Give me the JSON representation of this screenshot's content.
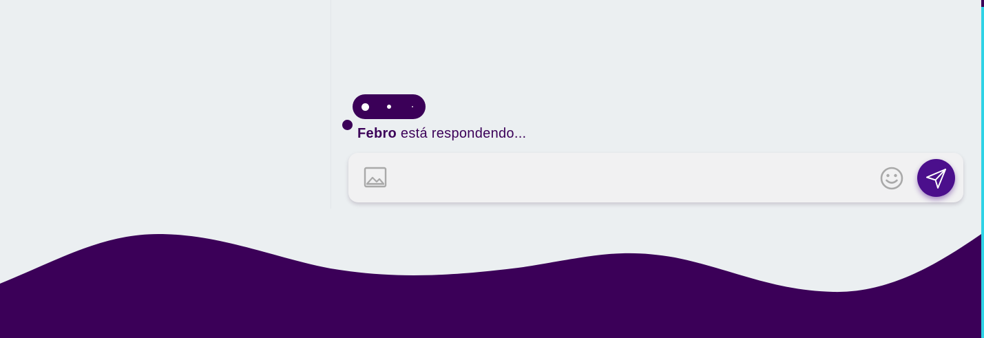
{
  "typing": {
    "name": "Febro",
    "status_text": " está respondendo..."
  },
  "composer": {
    "placeholder": "",
    "image_icon": "image-icon",
    "emoji_icon": "smiley-icon",
    "send_icon": "paper-plane-icon"
  },
  "colors": {
    "brand": "#3b0058",
    "send_button": "#4b0f8c",
    "background": "#ebeff1",
    "input_bg": "#f1f1f2",
    "accent": "#2fd3e6",
    "icon_gray": "#a9a9a9"
  }
}
